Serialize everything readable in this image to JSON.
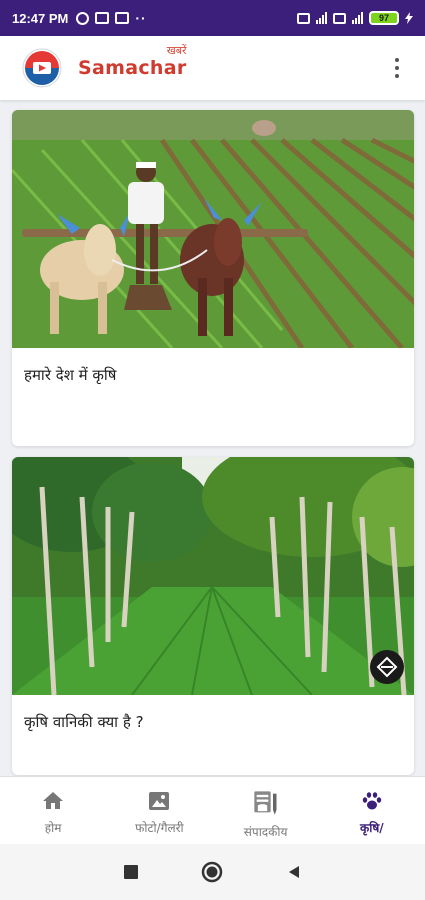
{
  "status_bar": {
    "time": "12:47 PM",
    "battery": "97"
  },
  "app": {
    "brand_top": "खबरें",
    "brand_name": "Samachar"
  },
  "feed": {
    "cards": [
      {
        "title": "हमारे देश में कृषि"
      },
      {
        "title": "कृषि वानिकी क्या है ?"
      }
    ]
  },
  "bottom_nav": {
    "items": [
      {
        "label": "होम",
        "icon": "home-icon"
      },
      {
        "label": "फोटो/गैलरी",
        "icon": "gallery-icon"
      },
      {
        "label": "संपादकीय",
        "icon": "editorial-icon"
      },
      {
        "label": "कृषि/",
        "icon": "paw-icon",
        "active": true
      }
    ]
  },
  "colors": {
    "status_bar": "#3c1f7a",
    "brand": "#cf3b2e",
    "active_nav": "#3c1f7a"
  }
}
